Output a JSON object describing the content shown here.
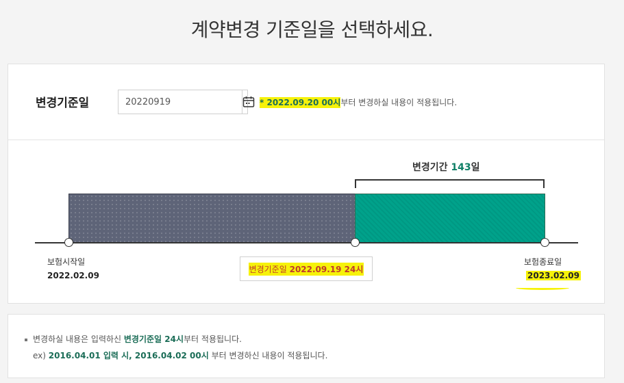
{
  "page": {
    "title": "계약변경 기준일을 선택하세요."
  },
  "form": {
    "label": "변경기준일",
    "date_value": "20220919",
    "notice_star": "*",
    "notice_date": "2022.09.20 00시",
    "notice_rest": "부터 변경하실 내용이 적용됩니다."
  },
  "timeline": {
    "period_label": "변경기간",
    "period_days": "143",
    "period_unit": "일",
    "start_label": "보험시작일",
    "start_date": "2022.02.09",
    "end_label": "보험종료일",
    "end_date": "2023.02.09",
    "change_label": "변경기준일",
    "change_date": "2022.09.19 24시",
    "elapsed_fraction": 0.6
  },
  "info": {
    "line1_a": "변경하실 내용은 입력하신 ",
    "line1_b": "변경기준일 24시",
    "line1_c": "부터 적용됩니다.",
    "line2_a": "ex) ",
    "line2_b": "2016.04.01 입력 시, 2016.04.02 00시",
    "line2_c": " 부터 변경하신 내용이 적용됩니다."
  },
  "colors": {
    "elapsed_bar": "#5e6478",
    "remaining_bar": "#00a28b",
    "accent_text": "#1b6d57",
    "highlight": "#f6f20a"
  },
  "icons": {
    "calendar": "calendar-icon"
  }
}
